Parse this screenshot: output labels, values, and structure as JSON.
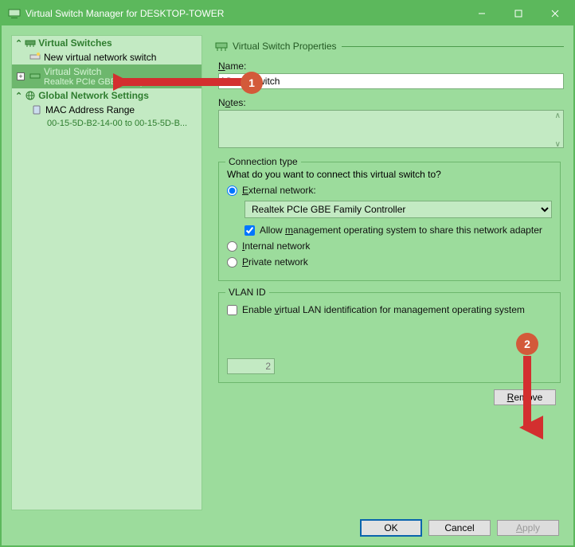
{
  "window": {
    "title": "Virtual Switch Manager for DESKTOP-TOWER"
  },
  "callouts": {
    "one": "1",
    "two": "2"
  },
  "sidebar": {
    "section_switches": "Virtual Switches",
    "new_switch": "New virtual network switch",
    "virtual_switch": "Virtual Switch",
    "virtual_switch_sub": "Realtek PCIe GBE Family Controller",
    "section_global": "Global Network Settings",
    "mac_range": "MAC Address Range",
    "mac_range_sub": "00-15-5D-B2-14-00 to 00-15-5D-B..."
  },
  "props": {
    "header": "Virtual Switch Properties",
    "name_label": "Name:",
    "name_value": "Virtual Switch",
    "notes_label": "Notes:",
    "notes_value": ""
  },
  "conn": {
    "legend": "Connection type",
    "question": "What do you want to connect this virtual switch to?",
    "external": "External network:",
    "adapter_selected": "Realtek PCIe GBE Family Controller",
    "allow_mgmt": "Allow management operating system to share this network adapter",
    "internal": "Internal network",
    "private": "Private network"
  },
  "vlan": {
    "legend": "VLAN ID",
    "enable": "Enable virtual LAN identification for management operating system",
    "id_value": "2"
  },
  "buttons": {
    "remove": "Remove",
    "ok": "OK",
    "cancel": "Cancel",
    "apply": "Apply"
  }
}
